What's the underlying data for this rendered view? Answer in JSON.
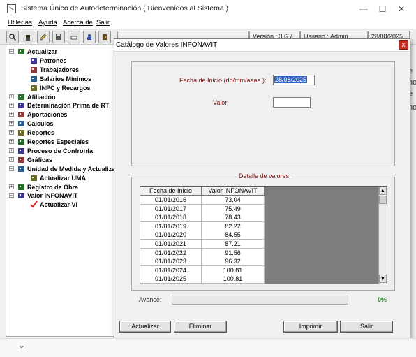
{
  "window": {
    "title": "Sistema Único de Autodeterminación ( Bienvenidos al Sistema )",
    "minimize": "—",
    "maximize": "☐",
    "close": "✕"
  },
  "menu": {
    "items": [
      "Utilerías",
      "Ayuda",
      "Acerca de",
      "Salir"
    ]
  },
  "status": {
    "version": "Versión : 3.6.7",
    "user": "Usuario : Admin",
    "date": "28/08/2025"
  },
  "tree": {
    "items": [
      {
        "label": "Actualizar",
        "level": 0,
        "expander": "–"
      },
      {
        "label": "Patrones",
        "level": 1
      },
      {
        "label": "Trabajadores",
        "level": 1
      },
      {
        "label": "Salarios Mínimos",
        "level": 1
      },
      {
        "label": "INPC y Recargos",
        "level": 1
      },
      {
        "label": "Afiliación",
        "level": 0,
        "expander": "+"
      },
      {
        "label": "Determinación Prima de RT",
        "level": 0,
        "expander": "+"
      },
      {
        "label": "Aportaciones",
        "level": 0,
        "expander": "+"
      },
      {
        "label": "Cálculos",
        "level": 0,
        "expander": "+"
      },
      {
        "label": "Reportes",
        "level": 0,
        "expander": "+"
      },
      {
        "label": "Reportes Especiales",
        "level": 0,
        "expander": "+"
      },
      {
        "label": "Proceso de Confronta",
        "level": 0,
        "expander": "+"
      },
      {
        "label": "Gráficas",
        "level": 0,
        "expander": "+"
      },
      {
        "label": "Unidad de Medida y Actualizac",
        "level": 0,
        "expander": "–"
      },
      {
        "label": "Actualizar UMA",
        "level": 1
      },
      {
        "label": "Registro de Obra",
        "level": 0,
        "expander": "+"
      },
      {
        "label": "Valor INFONAVIT",
        "level": 0,
        "expander": "–"
      },
      {
        "label": "Actualizar VI",
        "level": 1
      }
    ]
  },
  "dialog": {
    "title": "Catálogo de Valores INFONAVIT",
    "close": "x",
    "fecha_label": "Fecha de Inicio (dd/mm/aaaa ):",
    "fecha_value": "28/08/2025",
    "valor_label": "Valor:",
    "valor_value": "",
    "group_title": "Detalle de valores",
    "columns": [
      "Fecha de Inicio",
      "Valor INFONAVIT"
    ],
    "rows": [
      [
        "01/01/2016",
        "73.04"
      ],
      [
        "01/01/2017",
        "75.49"
      ],
      [
        "01/01/2018",
        "78.43"
      ],
      [
        "01/01/2019",
        "82.22"
      ],
      [
        "01/01/2020",
        "84.55"
      ],
      [
        "01/01/2021",
        "87.21"
      ],
      [
        "01/01/2022",
        "91.56"
      ],
      [
        "01/01/2023",
        "96.32"
      ],
      [
        "01/01/2024",
        "100.81"
      ],
      [
        "01/01/2025",
        "100.81"
      ]
    ],
    "avance_label": "Avance:",
    "progress": 0,
    "percent": "0%",
    "buttons": {
      "actualizar": "Actualizar",
      "eliminar": "Eliminar",
      "imprimir": "Imprimir",
      "salir": "Salir"
    }
  }
}
